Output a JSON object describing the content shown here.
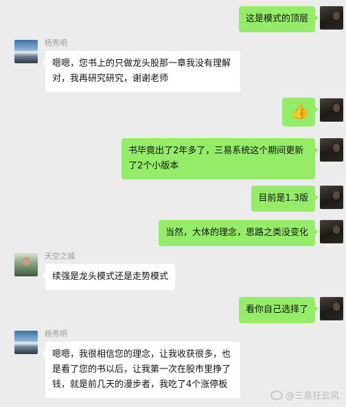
{
  "messages": [
    {
      "id": "m1",
      "side": "self",
      "text": "这是模式的顶层"
    },
    {
      "id": "m2",
      "side": "other",
      "sender": "杨秀明",
      "text": "嗯嗯，您书上的只做龙头股那一章我没有理解对，我再研究研究，谢谢老师"
    },
    {
      "id": "m3",
      "side": "self",
      "type": "emoji",
      "emoji": "👍",
      "icon": "thumbs-up-icon"
    },
    {
      "id": "m4",
      "side": "self",
      "text": "书毕竟出了2年多了，三易系统这个期间更新了2个小版本"
    },
    {
      "id": "m5",
      "side": "self",
      "text": "目前是1.3版"
    },
    {
      "id": "m6",
      "side": "self",
      "text": "当然，大体的理念，思路之类没变化"
    },
    {
      "id": "m7",
      "side": "other",
      "sender": "天空之城",
      "text": "续强是龙头模式还是走势模式"
    },
    {
      "id": "m8",
      "side": "self",
      "text": "看你自己选择了"
    },
    {
      "id": "m9",
      "side": "other",
      "sender": "杨秀明",
      "text": "嗯嗯，我很相信您的理念，让我收获很多，也是看了您的书以后，让我第一次在股市里挣了钱，就是前几天的漫步者，我吃了4个涨停板"
    }
  ],
  "watermark": {
    "text": "@三易狂云风",
    "icon": "weibo-icon"
  }
}
